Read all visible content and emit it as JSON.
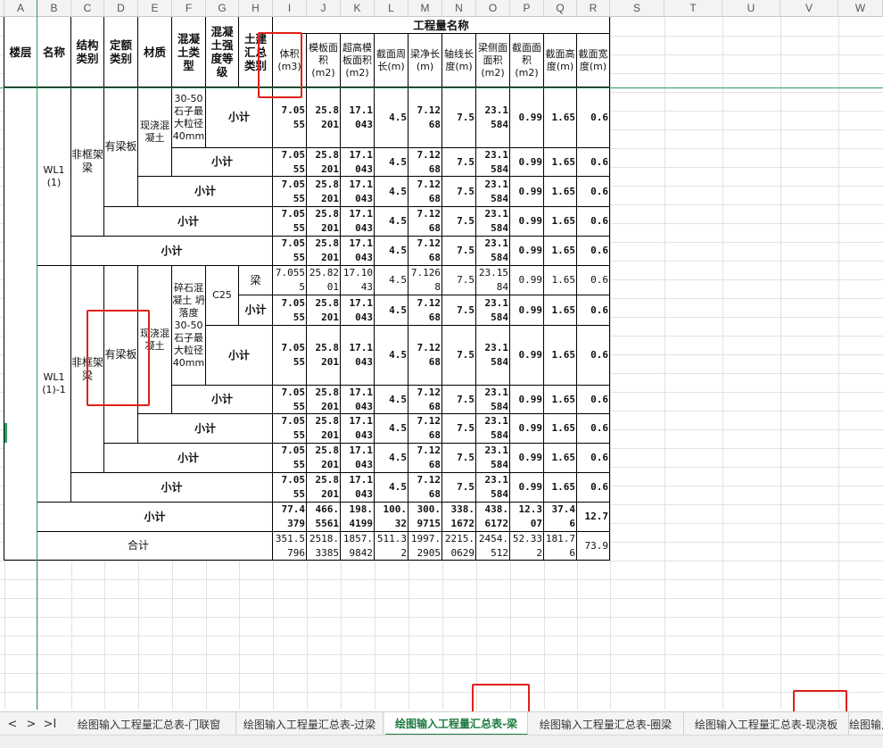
{
  "columns": [
    "A",
    "B",
    "C",
    "D",
    "E",
    "F",
    "G",
    "H",
    "I",
    "J",
    "K",
    "L",
    "M",
    "N",
    "O",
    "P",
    "Q",
    "R",
    "S",
    "T",
    "U",
    "V",
    "W"
  ],
  "headers": {
    "floor": "楼层",
    "name": "名称",
    "struct_type": "结构类别",
    "quota_type": "定额类别",
    "material": "材质",
    "concrete_type": "混凝土类型",
    "strength": "混凝土强度等级",
    "civil_type": "土建汇总类别",
    "quantity_name": "工程量名称",
    "volume": "体积(m3)",
    "formwork_area": "模板面积(m2)",
    "high_formwork_area": "超高模板面积(m2)",
    "perimeter": "截面周长(m)",
    "beam_net_length": "梁净长(m)",
    "axis_length": "轴线长度(m)",
    "beam_side_area": "梁侧面面积(m2)",
    "section_area": "截面面积(m2)",
    "section_height": "截面高度(m)",
    "section_width": "截面宽度(m)"
  },
  "labels": {
    "subtotal": "小计",
    "total": "合计",
    "non_frame_beam": "非框架梁",
    "with_slab": "有梁板",
    "cast_in_place": "现浇混凝土",
    "aggregate": "碎石混凝土 坍落度30-50 石子最大粒径40mm",
    "aggregate_cut": "30-50石子最大粒径40mm",
    "beam": "梁",
    "c25": "C25",
    "wl1_name": "WL1 (1)",
    "wl1_1_name": "WL1 (1)-1"
  },
  "values": {
    "std": [
      "7.0555",
      "25.8201",
      "17.1043",
      "4.5",
      "7.1268",
      "7.5",
      "23.1584",
      "0.99",
      "1.65",
      "0.6"
    ],
    "std_disp": [
      "7.05 55",
      "25.8 201",
      "17.1 043",
      "4.5",
      "7.12 68",
      "7.5",
      "23.1 584",
      "0.99",
      "1.65",
      "0.6"
    ],
    "plain_disp": [
      "7.055 5",
      "25.82 01",
      "17.10 43",
      "4.5",
      "7.126 8",
      "7.5",
      "23.15 84",
      "0.99",
      "1.65",
      "0.6"
    ],
    "subtotal_disp": [
      "77.4 379",
      "466. 5561",
      "198. 4199",
      "100. 32",
      "300. 9715",
      "338. 1672",
      "438. 6172",
      "12.3 07",
      "37.4 6",
      "12.7"
    ],
    "total_disp": [
      "351.5 796",
      "2518. 3385",
      "1857. 9842",
      "511.3 2",
      "1997. 2905",
      "2215. 0629",
      "2454. 512",
      "52.33 2",
      "181.7 6",
      "73.9"
    ]
  },
  "tabs": [
    "绘图输入工程量汇总表-门联窗",
    "绘图输入工程量汇总表-过梁",
    "绘图输入工程量汇总表-梁",
    "绘图输入工程量汇总表-圈梁",
    "绘图输入工程量汇总表-现浇板",
    "绘图输入"
  ],
  "active_tab": "绘图输入工程量汇总表-梁",
  "nav": {
    "prev": "<",
    "next": ">",
    "last": ">I"
  }
}
